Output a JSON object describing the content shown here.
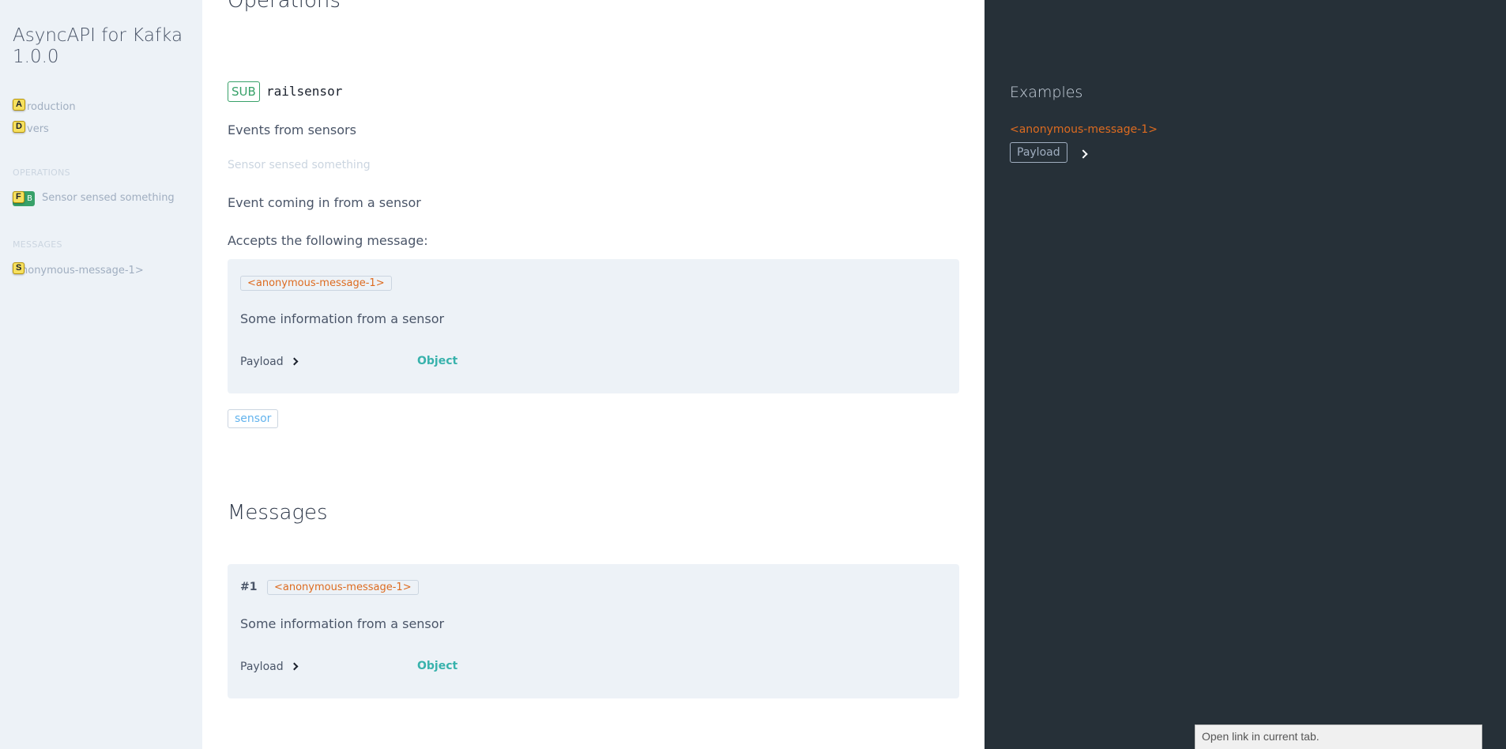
{
  "sidebar": {
    "title_line1": "AsyncAPI for Kafka",
    "title_line2": "1.0.0",
    "nav": [
      {
        "hint": "A",
        "label": "roduction"
      },
      {
        "hint": "D",
        "label": "vers"
      }
    ],
    "operations_label": "OPERATIONS",
    "operation": {
      "hint": "F",
      "badge": "B",
      "label": "Sensor sensed something"
    },
    "messages_label": "MESSAGES",
    "message": {
      "hint": "S",
      "label": "nonymous-message-1>"
    }
  },
  "main": {
    "operations_heading": "Operations",
    "operation": {
      "tag": "SUB",
      "channel": "railsensor",
      "channel_description": "Events from sensors",
      "summary": "Sensor sensed something",
      "description": "Event coming in from a sensor",
      "accepts": "Accepts the following message:",
      "message": {
        "name": "<anonymous-message-1>",
        "description": "Some information from a sensor",
        "payload_label": "Payload",
        "payload_type": "Object"
      },
      "tags": [
        "sensor"
      ]
    },
    "messages_heading": "Messages",
    "messages": [
      {
        "index": "#1",
        "name": "<anonymous-message-1>",
        "description": "Some information from a sensor",
        "payload_label": "Payload",
        "payload_type": "Object"
      }
    ]
  },
  "examples": {
    "title": "Examples",
    "message_name": "<anonymous-message-1>",
    "payload_button": "Payload"
  },
  "status_tooltip": "Open link in current tab.",
  "colors": {
    "sidebar_bg": "#edf2f7",
    "examples_bg": "#263038",
    "accent_green": "#38a169",
    "message_orange": "#dd6b20",
    "type_teal": "#38b2ac",
    "hint_yellow": "#f6e05e"
  }
}
